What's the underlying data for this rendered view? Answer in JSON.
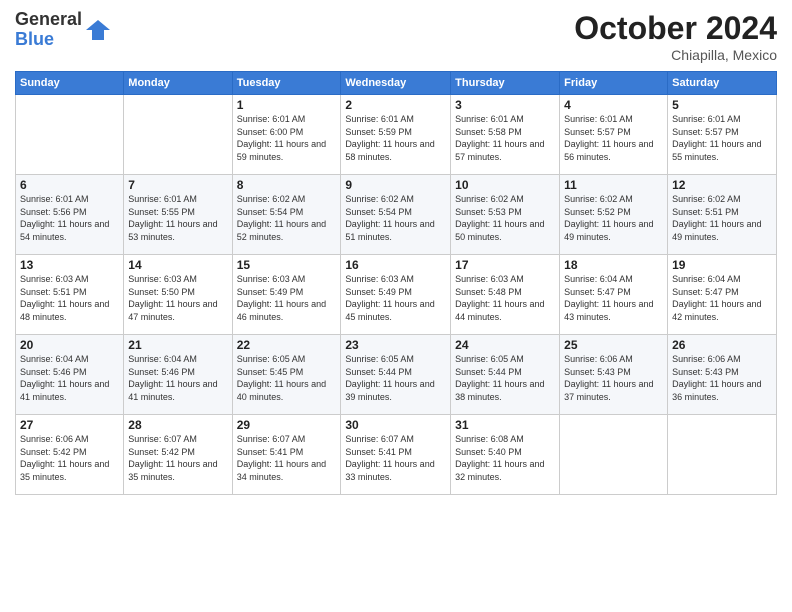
{
  "header": {
    "logo_general": "General",
    "logo_blue": "Blue",
    "month_title": "October 2024",
    "location": "Chiapilla, Mexico"
  },
  "weekdays": [
    "Sunday",
    "Monday",
    "Tuesday",
    "Wednesday",
    "Thursday",
    "Friday",
    "Saturday"
  ],
  "weeks": [
    [
      {
        "day": "",
        "info": ""
      },
      {
        "day": "",
        "info": ""
      },
      {
        "day": "1",
        "info": "Sunrise: 6:01 AM\nSunset: 6:00 PM\nDaylight: 11 hours and 59 minutes."
      },
      {
        "day": "2",
        "info": "Sunrise: 6:01 AM\nSunset: 5:59 PM\nDaylight: 11 hours and 58 minutes."
      },
      {
        "day": "3",
        "info": "Sunrise: 6:01 AM\nSunset: 5:58 PM\nDaylight: 11 hours and 57 minutes."
      },
      {
        "day": "4",
        "info": "Sunrise: 6:01 AM\nSunset: 5:57 PM\nDaylight: 11 hours and 56 minutes."
      },
      {
        "day": "5",
        "info": "Sunrise: 6:01 AM\nSunset: 5:57 PM\nDaylight: 11 hours and 55 minutes."
      }
    ],
    [
      {
        "day": "6",
        "info": "Sunrise: 6:01 AM\nSunset: 5:56 PM\nDaylight: 11 hours and 54 minutes."
      },
      {
        "day": "7",
        "info": "Sunrise: 6:01 AM\nSunset: 5:55 PM\nDaylight: 11 hours and 53 minutes."
      },
      {
        "day": "8",
        "info": "Sunrise: 6:02 AM\nSunset: 5:54 PM\nDaylight: 11 hours and 52 minutes."
      },
      {
        "day": "9",
        "info": "Sunrise: 6:02 AM\nSunset: 5:54 PM\nDaylight: 11 hours and 51 minutes."
      },
      {
        "day": "10",
        "info": "Sunrise: 6:02 AM\nSunset: 5:53 PM\nDaylight: 11 hours and 50 minutes."
      },
      {
        "day": "11",
        "info": "Sunrise: 6:02 AM\nSunset: 5:52 PM\nDaylight: 11 hours and 49 minutes."
      },
      {
        "day": "12",
        "info": "Sunrise: 6:02 AM\nSunset: 5:51 PM\nDaylight: 11 hours and 49 minutes."
      }
    ],
    [
      {
        "day": "13",
        "info": "Sunrise: 6:03 AM\nSunset: 5:51 PM\nDaylight: 11 hours and 48 minutes."
      },
      {
        "day": "14",
        "info": "Sunrise: 6:03 AM\nSunset: 5:50 PM\nDaylight: 11 hours and 47 minutes."
      },
      {
        "day": "15",
        "info": "Sunrise: 6:03 AM\nSunset: 5:49 PM\nDaylight: 11 hours and 46 minutes."
      },
      {
        "day": "16",
        "info": "Sunrise: 6:03 AM\nSunset: 5:49 PM\nDaylight: 11 hours and 45 minutes."
      },
      {
        "day": "17",
        "info": "Sunrise: 6:03 AM\nSunset: 5:48 PM\nDaylight: 11 hours and 44 minutes."
      },
      {
        "day": "18",
        "info": "Sunrise: 6:04 AM\nSunset: 5:47 PM\nDaylight: 11 hours and 43 minutes."
      },
      {
        "day": "19",
        "info": "Sunrise: 6:04 AM\nSunset: 5:47 PM\nDaylight: 11 hours and 42 minutes."
      }
    ],
    [
      {
        "day": "20",
        "info": "Sunrise: 6:04 AM\nSunset: 5:46 PM\nDaylight: 11 hours and 41 minutes."
      },
      {
        "day": "21",
        "info": "Sunrise: 6:04 AM\nSunset: 5:46 PM\nDaylight: 11 hours and 41 minutes."
      },
      {
        "day": "22",
        "info": "Sunrise: 6:05 AM\nSunset: 5:45 PM\nDaylight: 11 hours and 40 minutes."
      },
      {
        "day": "23",
        "info": "Sunrise: 6:05 AM\nSunset: 5:44 PM\nDaylight: 11 hours and 39 minutes."
      },
      {
        "day": "24",
        "info": "Sunrise: 6:05 AM\nSunset: 5:44 PM\nDaylight: 11 hours and 38 minutes."
      },
      {
        "day": "25",
        "info": "Sunrise: 6:06 AM\nSunset: 5:43 PM\nDaylight: 11 hours and 37 minutes."
      },
      {
        "day": "26",
        "info": "Sunrise: 6:06 AM\nSunset: 5:43 PM\nDaylight: 11 hours and 36 minutes."
      }
    ],
    [
      {
        "day": "27",
        "info": "Sunrise: 6:06 AM\nSunset: 5:42 PM\nDaylight: 11 hours and 35 minutes."
      },
      {
        "day": "28",
        "info": "Sunrise: 6:07 AM\nSunset: 5:42 PM\nDaylight: 11 hours and 35 minutes."
      },
      {
        "day": "29",
        "info": "Sunrise: 6:07 AM\nSunset: 5:41 PM\nDaylight: 11 hours and 34 minutes."
      },
      {
        "day": "30",
        "info": "Sunrise: 6:07 AM\nSunset: 5:41 PM\nDaylight: 11 hours and 33 minutes."
      },
      {
        "day": "31",
        "info": "Sunrise: 6:08 AM\nSunset: 5:40 PM\nDaylight: 11 hours and 32 minutes."
      },
      {
        "day": "",
        "info": ""
      },
      {
        "day": "",
        "info": ""
      }
    ]
  ]
}
